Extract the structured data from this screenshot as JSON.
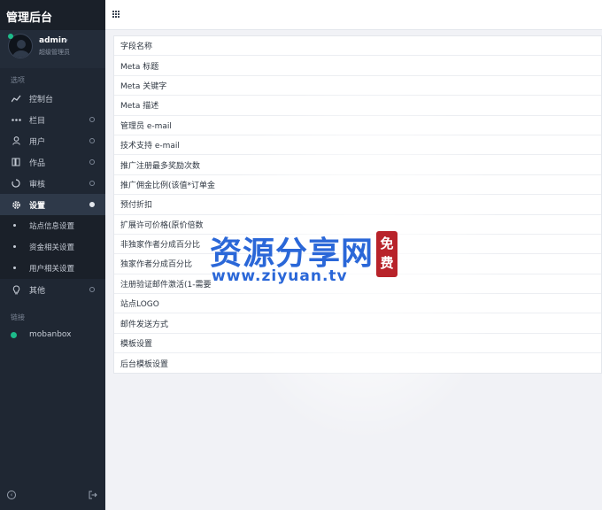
{
  "app": {
    "title": "管理后台"
  },
  "user": {
    "name": "admin",
    "caret": "▾",
    "role": "超级管理员"
  },
  "sidebar": {
    "section_label": "选项",
    "items": [
      {
        "label": "控制台",
        "icon": "chart-line-icon"
      },
      {
        "label": "栏目",
        "icon": "dots-icon"
      },
      {
        "label": "用户",
        "icon": "user-icon"
      },
      {
        "label": "作品",
        "icon": "book-icon"
      },
      {
        "label": "审核",
        "icon": "spinner-icon"
      },
      {
        "label": "设置",
        "icon": "gear-icon"
      }
    ],
    "sub_items": [
      {
        "label": "站点信息设置"
      },
      {
        "label": "资金相关设置"
      },
      {
        "label": "用户相关设置"
      }
    ],
    "other": {
      "label": "其他",
      "icon": "bulb-icon"
    },
    "links_label": "链接",
    "links": [
      {
        "label": "mobanbox",
        "color": "#1dbb8a"
      }
    ]
  },
  "settings_rows": [
    "字段名称",
    "Meta 标题",
    "Meta 关键字",
    "Meta 描述",
    "管理员 e-mail",
    "技术支持 e-mail",
    "推广注册最多奖励次数",
    "推广佣金比例(该值*订单金",
    "预付折扣",
    "扩展许可价格(原价倍数",
    "非独家作者分成百分比",
    "独家作者分成百分比",
    "注册验证邮件激活(1-需要",
    "站点LOGO",
    "邮件发送方式",
    "模板设置",
    "后台模板设置"
  ],
  "watermark": {
    "brand": "资源分享网",
    "url": "www.ziyuan.tv",
    "seal": "免费"
  },
  "colors": {
    "sidebar_bg": "#1f2733",
    "accent_green": "#1dbb8a",
    "watermark_blue": "#2a67d8",
    "seal_red": "#b8232a"
  }
}
